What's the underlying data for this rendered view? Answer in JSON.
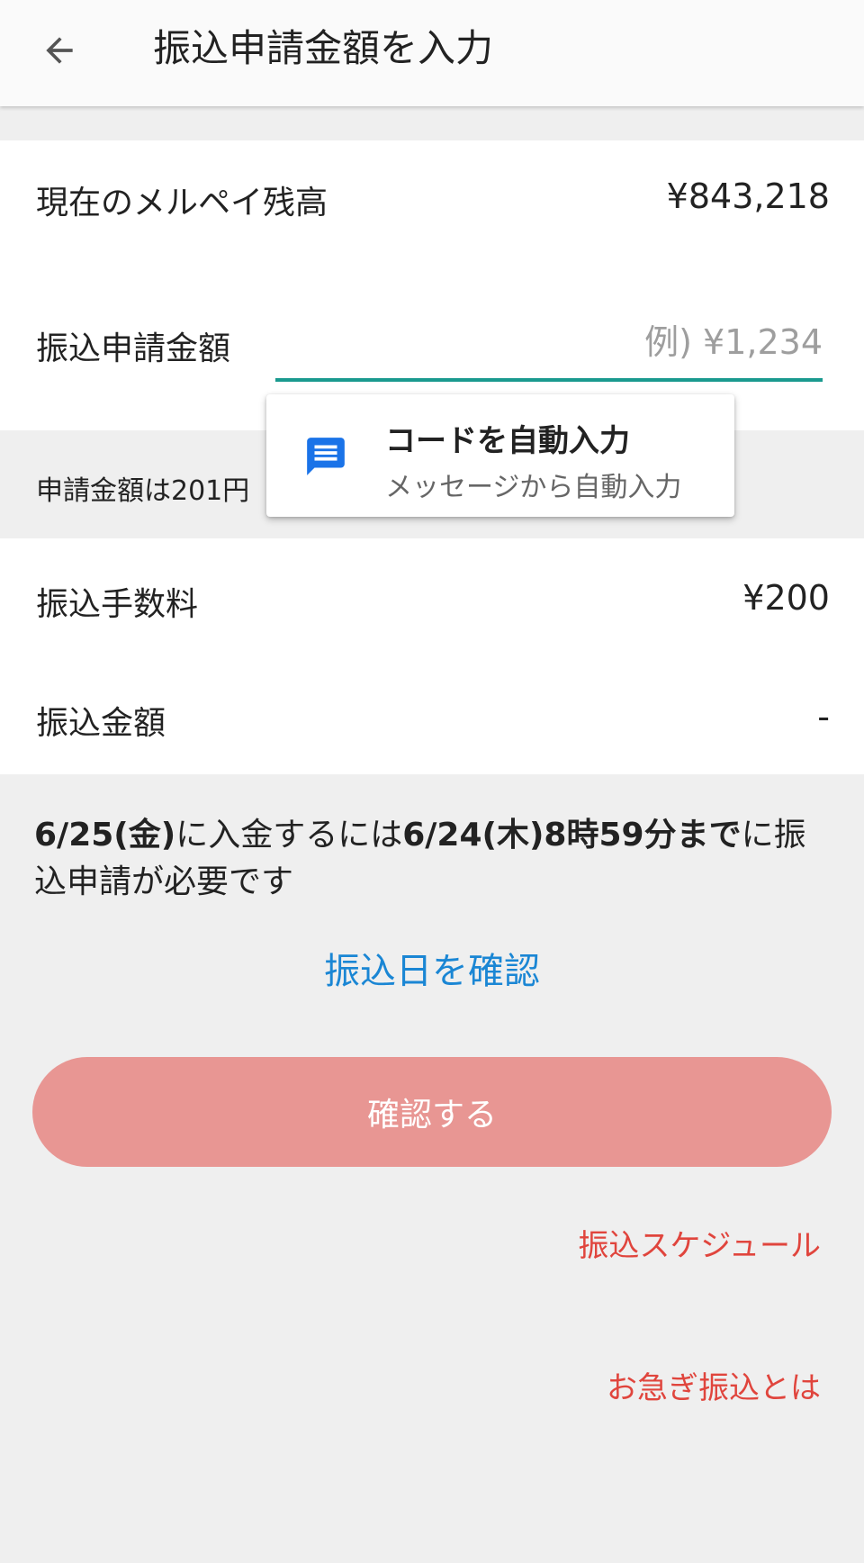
{
  "appbar": {
    "title": "振込申請金額を入力"
  },
  "balance": {
    "label": "現在のメルペイ残高",
    "value": "¥843,218"
  },
  "request_amount": {
    "label": "振込申請金額",
    "placeholder": "例) ¥1,234",
    "value": ""
  },
  "info": {
    "text": "申請金額は201円"
  },
  "autofill": {
    "title": "コードを自動入力",
    "subtitle": "メッセージから自動入力"
  },
  "fee": {
    "label": "振込手数料",
    "value": "¥200"
  },
  "transfer_amount": {
    "label": "振込金額",
    "value": "-"
  },
  "deadline": {
    "date1": "6/25(金)",
    "mid": "に入金するには",
    "date2": "6/24(木)8時59分まで",
    "tail": "に振込申請が必要です"
  },
  "links": {
    "check_date": "振込日を確認",
    "schedule": "振込スケジュール",
    "urgent": "お急ぎ振込とは"
  },
  "confirm_button": "確認する",
  "colors": {
    "accent_teal": "#1a9a8f",
    "link_blue": "#1a86d4",
    "link_red": "#e0453d",
    "button_disabled": "#e89693",
    "autofill_icon": "#1a73e8"
  }
}
